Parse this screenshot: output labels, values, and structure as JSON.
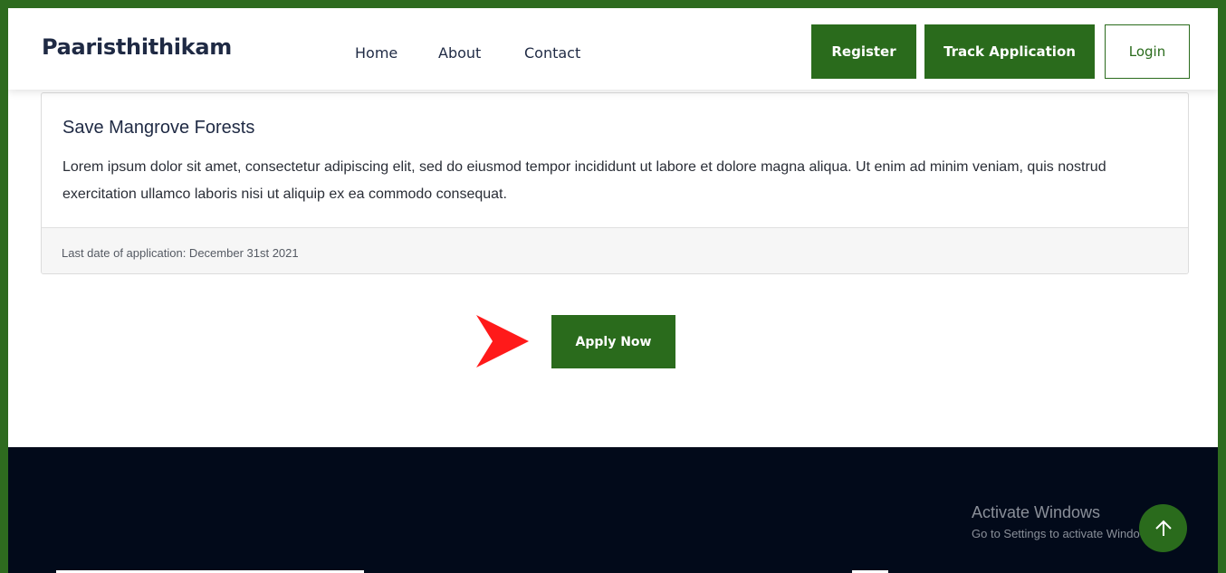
{
  "header": {
    "brand": "Paaristhithikam",
    "nav": [
      "Home",
      "About",
      "Contact"
    ],
    "register_label": "Register",
    "track_label": "Track Application",
    "login_label": "Login"
  },
  "card": {
    "title": "Save Mangrove Forests",
    "description": "Lorem ipsum dolor sit amet, consectetur adipiscing elit, sed do eiusmod tempor incididunt ut labore et dolore magna aliqua. Ut enim ad minim veniam, quis nostrud exercitation ullamco laboris nisi ut aliquip ex ea commodo consequat.",
    "footer_text": "Last date of application: December 31st 2021"
  },
  "apply": {
    "label": "Apply Now"
  },
  "watermark": {
    "title": "Activate Windows",
    "subtitle": "Go to Settings to activate Windows."
  },
  "icons": {
    "arrow": "pointer-arrow-icon",
    "scroll_top": "arrow-up-icon"
  },
  "colors": {
    "brand_green": "#2a6b1c",
    "frame_green": "#2e6b1f",
    "footer_bg": "#020a1a",
    "arrow_red": "#ff1a1a"
  }
}
